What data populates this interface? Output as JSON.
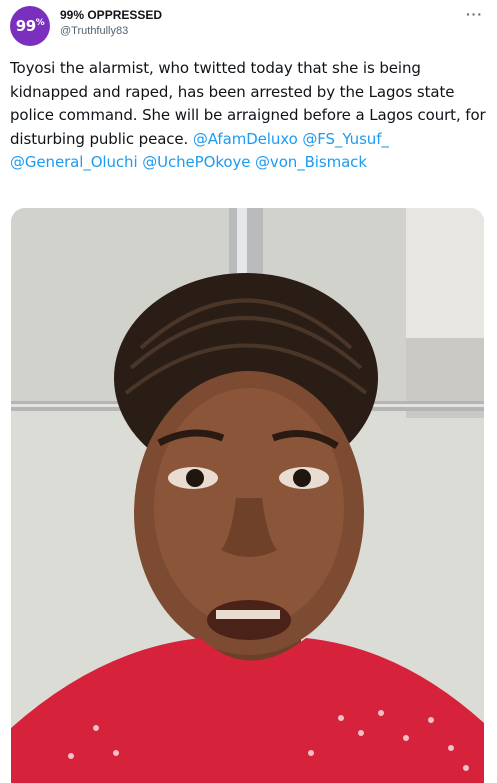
{
  "tweet": {
    "author": {
      "avatar_text": "99",
      "avatar_sup": "%",
      "display_name": "99% OPPRESSED",
      "handle": "@Truthfully83"
    },
    "more_icon": "more-dots-icon",
    "text_parts": [
      "Toyosi the alarmist, who twitted today that she is being kidnapped and raped, has been arrested by the Lagos state police command. She will be arraigned before a Lagos court, for disturbing public peace. "
    ],
    "mentions": [
      "@AfamDeluxo",
      "@FS_Yusuf_",
      "@General_Oluchi",
      "@UchePOkoye",
      "@von_Bismack"
    ],
    "media": {
      "type": "photo",
      "description_icon": "photo-woman-portrait"
    },
    "colors": {
      "mention": "#1d9bf0",
      "avatar": "#7b2fbe",
      "shirt": "#d6223a"
    }
  }
}
